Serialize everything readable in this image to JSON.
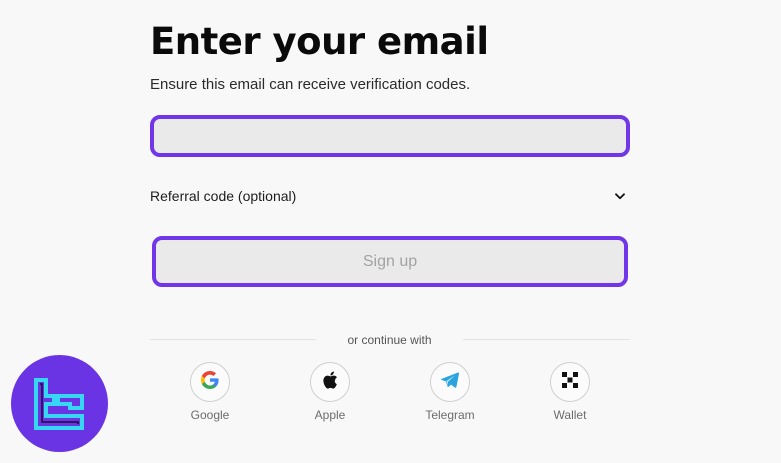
{
  "heading": "Enter your email",
  "subheading": "Ensure this email can receive verification codes.",
  "email_field": {
    "value": "",
    "placeholder": ""
  },
  "referral": {
    "label": "Referral code (optional)",
    "icon": "chevron-down-icon"
  },
  "signup_button": {
    "label": "Sign up"
  },
  "divider_text": "or continue with",
  "social": [
    {
      "label": "Google",
      "icon": "google-icon"
    },
    {
      "label": "Apple",
      "icon": "apple-icon"
    },
    {
      "label": "Telegram",
      "icon": "telegram-icon"
    },
    {
      "label": "Wallet",
      "icon": "wallet-icon"
    }
  ],
  "colors": {
    "accent": "#7136e8",
    "logo_bg": "#6a33e3",
    "logo_stroke": "#38d6f5"
  }
}
